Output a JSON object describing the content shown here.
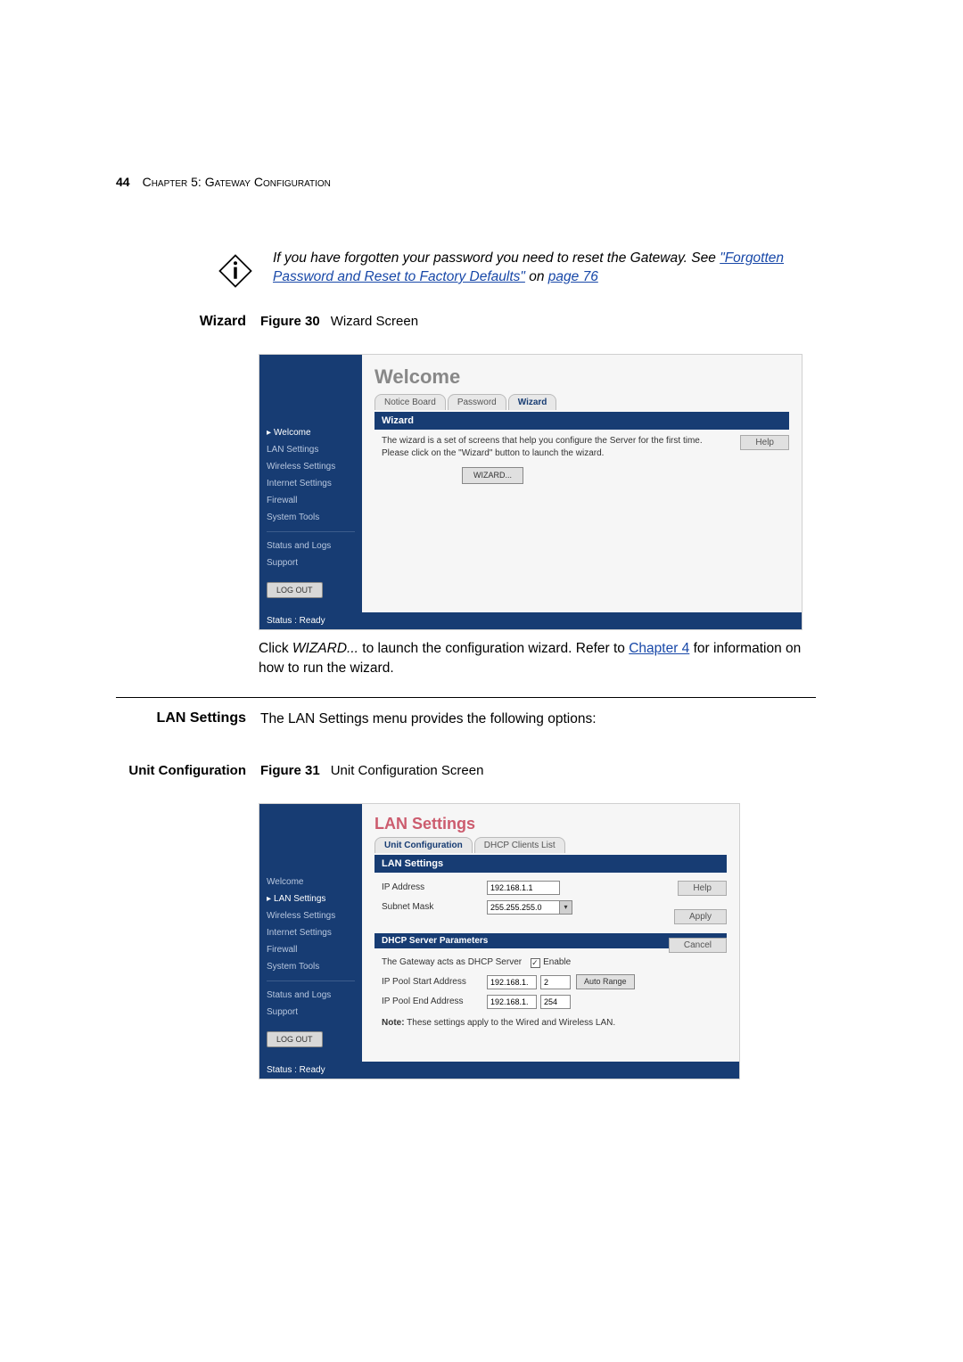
{
  "page_num": "44",
  "chapter": "Chapter 5: Gateway Configuration",
  "info_note": {
    "line1": "If you have forgotten your password you need to reset the Gateway. See ",
    "link": "\"Forgotten Password and Reset to Factory Defaults\"",
    "on": " on ",
    "pagelink": "page 76"
  },
  "wizard_section": {
    "label": "Wizard",
    "fig_label": "Figure 30",
    "fig_caption": "Wizard Screen"
  },
  "wizard_shot": {
    "title": "Welcome",
    "tabs": [
      "Notice Board",
      "Password",
      "Wizard"
    ],
    "active_tab": "Wizard",
    "panel_header": "Wizard",
    "desc_line1": "The wizard is a set of screens that help you configure the Server for the first time.",
    "desc_line2": "Please click on the \"Wizard\" button to launch the wizard.",
    "wizard_button": "WIZARD...",
    "sidebar": {
      "items": [
        "Welcome",
        "LAN Settings",
        "Wireless Settings",
        "Internet Settings",
        "Firewall",
        "System Tools"
      ],
      "items2": [
        "Status and Logs",
        "Support"
      ],
      "logout": "LOG OUT"
    },
    "help_btn": "Help",
    "status": "Status : Ready"
  },
  "wizard_body": {
    "text1": "Click ",
    "italic": "WIZARD...",
    "text2": " to launch the configuration wizard. Refer to ",
    "link": "Chapter 4",
    "text3": " for information on how to run the wizard."
  },
  "lan_section": {
    "label": "LAN Settings",
    "body": "The LAN Settings menu provides the following options:"
  },
  "unit_section": {
    "label": "Unit Configuration",
    "fig_label": "Figure 31",
    "fig_caption": "Unit Configuration Screen"
  },
  "lan_shot": {
    "title": "LAN Settings",
    "tabs": [
      "Unit Configuration",
      "DHCP Clients List"
    ],
    "active_tab": "Unit Configuration",
    "panel_header": "LAN Settings",
    "ip_label": "IP Address",
    "ip_value": "192.168.1.1",
    "mask_label": "Subnet Mask",
    "mask_value": "255.255.255.0",
    "dhcp_header": "DHCP Server Parameters",
    "dhcp_enable_label": "The Gateway acts as DHCP Server",
    "enable_label": "Enable",
    "pool_start_label": "IP Pool Start Address",
    "pool_start_prefix": "192.168.1.",
    "pool_start_suffix": "2",
    "pool_end_label": "IP Pool End Address",
    "pool_end_prefix": "192.168.1.",
    "pool_end_suffix": "254",
    "auto_range_btn": "Auto Range",
    "note_label": "Note:",
    "note_text": " These settings apply to the Wired and Wireless LAN.",
    "sidebar": {
      "items": [
        "Welcome",
        "LAN Settings",
        "Wireless Settings",
        "Internet Settings",
        "Firewall",
        "System Tools"
      ],
      "items2": [
        "Status and Logs",
        "Support"
      ],
      "logout": "LOG OUT"
    },
    "help_btn": "Help",
    "apply_btn": "Apply",
    "cancel_btn": "Cancel",
    "status": "Status : Ready"
  }
}
